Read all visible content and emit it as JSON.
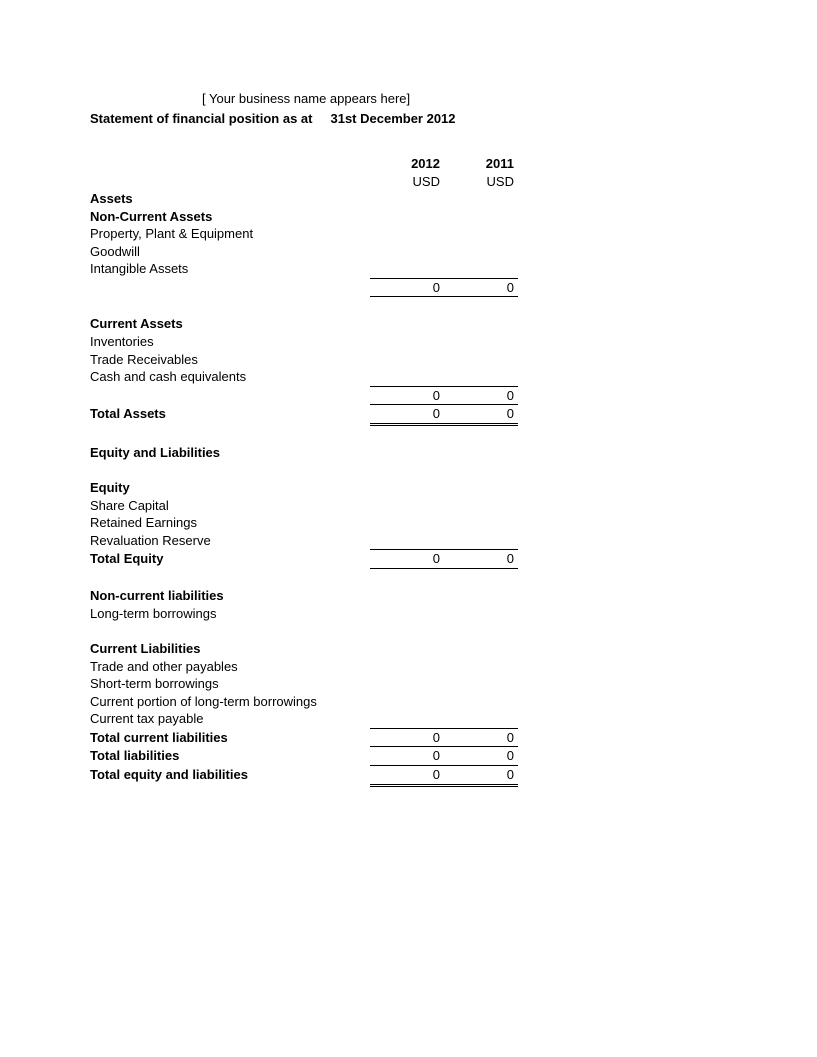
{
  "header": {
    "business_name": "[ Your business name appears here]",
    "statement_label": "Statement of financial position as at",
    "statement_date": "31st December  2012"
  },
  "columns": {
    "year1": "2012",
    "year2": "2011",
    "currency": "USD"
  },
  "sections": {
    "assets": "Assets",
    "non_current_assets": "Non-Current Assets",
    "ppe": "Property, Plant & Equipment",
    "goodwill": "Goodwill",
    "intangible": "Intangible Assets",
    "nca_total_y1": "0",
    "nca_total_y2": "0",
    "current_assets": "Current Assets",
    "inventories": "Inventories",
    "trade_recv": "Trade Receivables",
    "cash": "Cash and cash equivalents",
    "ca_total_y1": "0",
    "ca_total_y2": "0",
    "total_assets_label": "Total Assets",
    "total_assets_y1": "0",
    "total_assets_y2": "0",
    "equity_liab": "Equity and Liabilities",
    "equity": "Equity",
    "share_capital": "Share Capital",
    "retained": "Retained Earnings",
    "reval": "Revaluation Reserve",
    "total_equity_label": "Total Equity",
    "total_equity_y1": "0",
    "total_equity_y2": "0",
    "non_current_liab": "Non-current liabilities",
    "long_term": "Long-term borrowings",
    "current_liab": "Current Liabilities",
    "trade_pay": "Trade and other payables",
    "short_term": "Short-term borrowings",
    "current_portion": "Current portion of long-term borrowings",
    "tax_payable": "Current tax payable",
    "total_cl_label": "Total current liabilities",
    "total_cl_y1": "0",
    "total_cl_y2": "0",
    "total_liab_label": "Total liabilities",
    "total_liab_y1": "0",
    "total_liab_y2": "0",
    "total_el_label": "Total equity and liabilities",
    "total_el_y1": "0",
    "total_el_y2": "0"
  }
}
